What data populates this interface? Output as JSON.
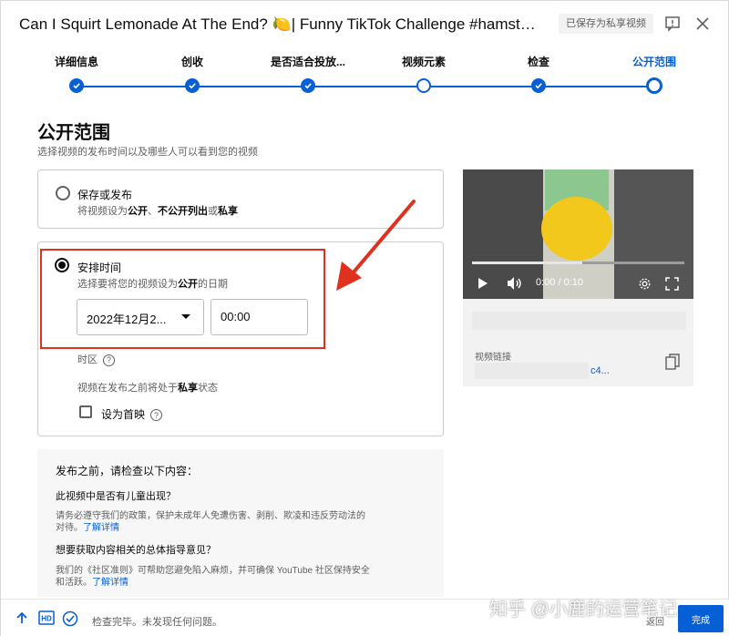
{
  "header": {
    "title": "Can I Squirt Lemonade At The End? 🍋| Funny TikTok Challenge #hamster...",
    "save_status": "已保存为私享视频"
  },
  "stepper": {
    "steps": [
      {
        "label": "详细信息",
        "state": "done"
      },
      {
        "label": "创收",
        "state": "done"
      },
      {
        "label": "是否适合投放...",
        "state": "done"
      },
      {
        "label": "视频元素",
        "state": "open"
      },
      {
        "label": "检查",
        "state": "done"
      },
      {
        "label": "公开范围",
        "state": "current"
      }
    ]
  },
  "page": {
    "heading": "公开范围",
    "subheading": "选择视频的发布时间以及哪些人可以看到您的视频"
  },
  "option_save": {
    "title": "保存或发布",
    "desc_prefix": "将视频设为",
    "desc_bold1": "公开",
    "desc_mid": "、",
    "desc_bold2": "不公开列出",
    "desc_or": "或",
    "desc_bold3": "私享"
  },
  "option_schedule": {
    "title": "安排时间",
    "desc_prefix": "选择要将您的视频设为",
    "desc_bold": "公开",
    "desc_suffix": "的日期",
    "date_value": "2022年12月2...",
    "time_value": "00:00",
    "timezone_label": "时区",
    "private_note_prefix": "视频在发布之前将处于",
    "private_note_bold": "私享",
    "private_note_suffix": "状态",
    "premiere_label": "设为首映"
  },
  "check_panel": {
    "heading": "发布之前，请检查以下内容：",
    "q1_title": "此视频中是否有儿童出现？",
    "q1_line1": "请务必遵守我们的政策，保护未成年人免遭伤害、剥削、欺凌和违反劳动法的",
    "q1_line2": "对待。",
    "q1_link": "了解详情",
    "q2_title": "想要获取内容相关的总体指导意见？",
    "q2_line1": "我们的《社区准则》可帮助您避免陷入麻烦，并可确保 YouTube 社区保持安全",
    "q2_line2": "和活跃。",
    "q2_link": "了解详情"
  },
  "preview": {
    "time_display": "0:00 / 0:10",
    "progress": 0.52,
    "link_label": "视频链接",
    "link_value": "c4..."
  },
  "footer": {
    "status_text": "检查完毕。未发现任何问题。",
    "back_label": "返回",
    "done_label": "完成"
  },
  "watermark": "知乎 @小鹿的运营笔记",
  "colors": {
    "accent": "#065fd4",
    "annotation_red": "#e0301e"
  }
}
